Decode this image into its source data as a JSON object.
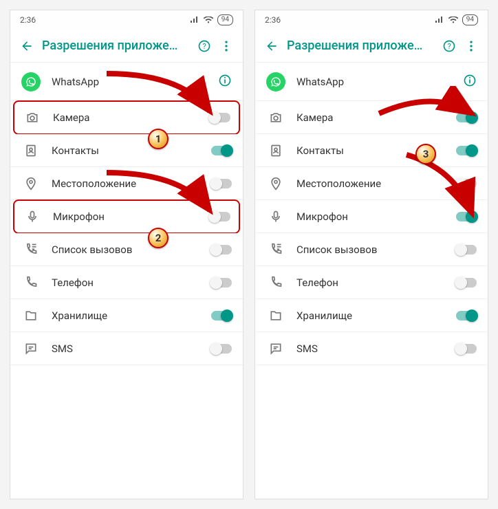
{
  "status": {
    "time": "2:36",
    "battery": "94"
  },
  "header": {
    "title": "Разрешения приложе…"
  },
  "app": {
    "name": "WhatsApp"
  },
  "badges": {
    "b1": "1",
    "b2": "2",
    "b3": "3"
  },
  "left": {
    "rows": [
      {
        "icon": "camera",
        "label": "Камера",
        "on": false,
        "highlight": true
      },
      {
        "icon": "contacts",
        "label": "Контакты",
        "on": true
      },
      {
        "icon": "location",
        "label": "Местоположение",
        "on": false
      },
      {
        "icon": "mic",
        "label": "Микрофон",
        "on": false,
        "highlight": true
      },
      {
        "icon": "calllog",
        "label": "Список вызовов",
        "on": false
      },
      {
        "icon": "phone",
        "label": "Телефон",
        "on": false
      },
      {
        "icon": "storage",
        "label": "Хранилище",
        "on": true
      },
      {
        "icon": "sms",
        "label": "SMS",
        "on": false
      }
    ]
  },
  "right": {
    "rows": [
      {
        "icon": "camera",
        "label": "Камера",
        "on": true
      },
      {
        "icon": "contacts",
        "label": "Контакты",
        "on": true
      },
      {
        "icon": "location",
        "label": "Местоположение",
        "on": false
      },
      {
        "icon": "mic",
        "label": "Микрофон",
        "on": true
      },
      {
        "icon": "calllog",
        "label": "Список вызовов",
        "on": false
      },
      {
        "icon": "phone",
        "label": "Телефон",
        "on": false
      },
      {
        "icon": "storage",
        "label": "Хранилище",
        "on": true
      },
      {
        "icon": "sms",
        "label": "SMS",
        "on": false
      }
    ]
  }
}
